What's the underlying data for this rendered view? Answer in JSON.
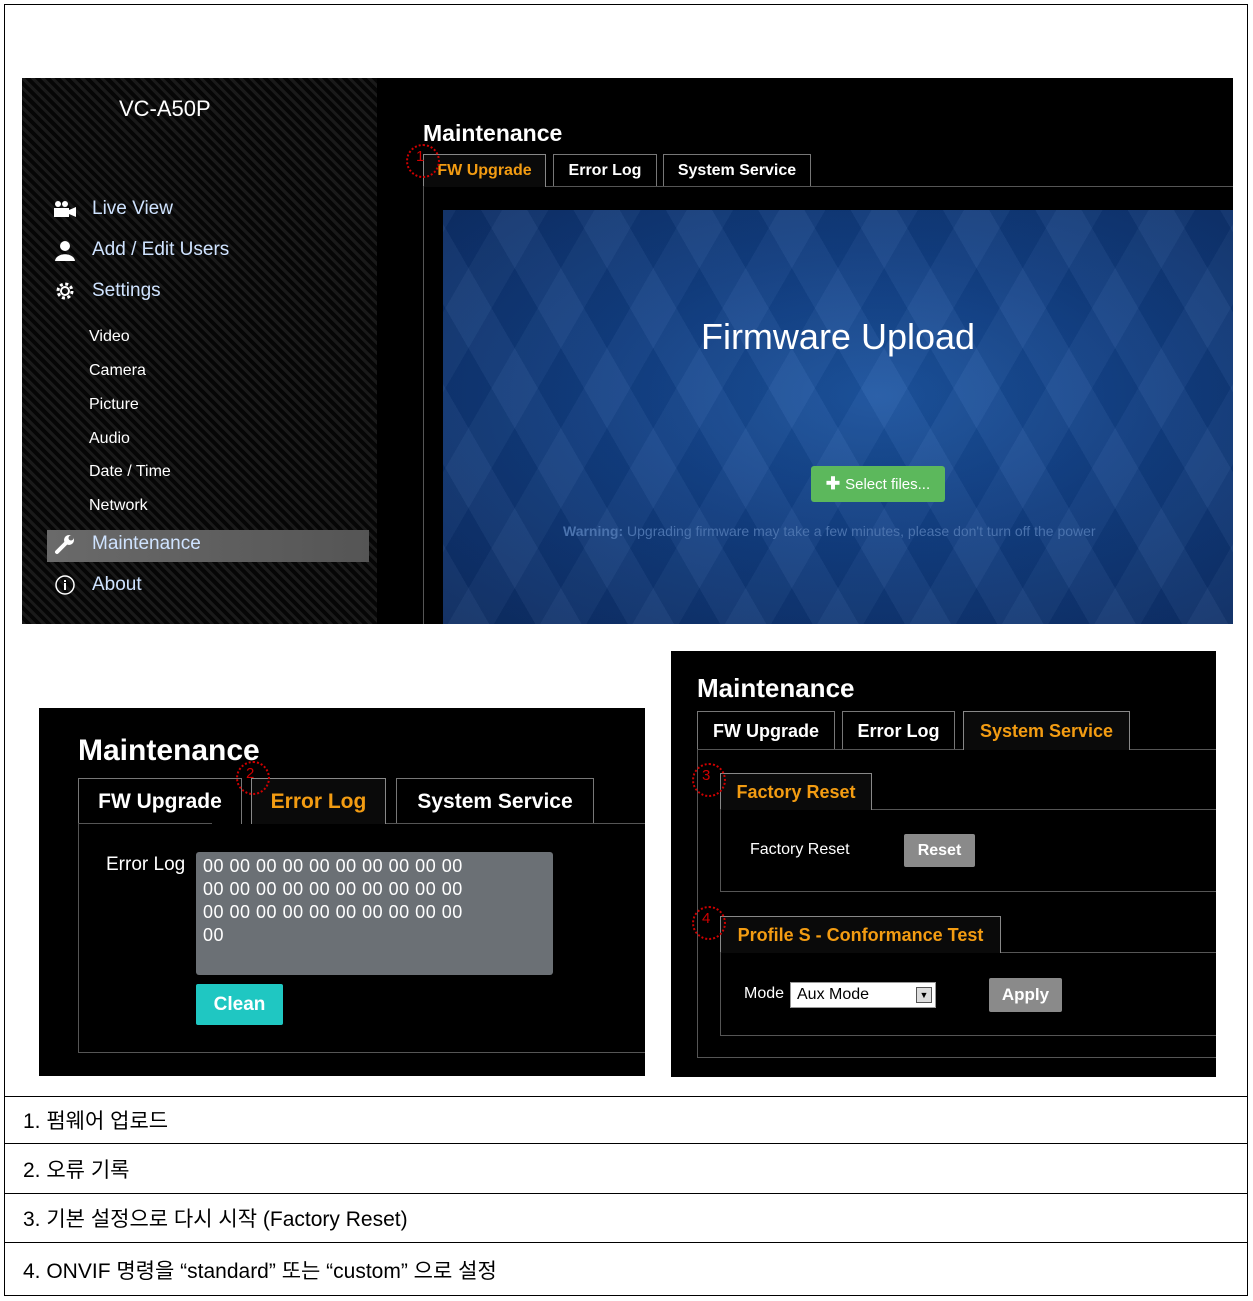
{
  "main": {
    "brand": "VC-A50P",
    "nav": [
      {
        "label": "Live View",
        "icon": "video-camera-icon"
      },
      {
        "label": "Add / Edit Users",
        "icon": "user-icon"
      },
      {
        "label": "Settings",
        "icon": "gear-icon"
      }
    ],
    "settings_sub": [
      "Video",
      "Camera",
      "Picture",
      "Audio",
      "Date / Time",
      "Network"
    ],
    "nav_bottom": [
      {
        "label": "Maintenance",
        "icon": "wrench-icon",
        "active": true
      },
      {
        "label": "About",
        "icon": "info-icon"
      }
    ],
    "title": "Maintenance",
    "tabs": [
      "FW Upgrade",
      "Error Log",
      "System Service"
    ],
    "active_tab": "FW Upgrade",
    "fw_title": "Firmware Upload",
    "select_files": "Select files...",
    "warning_label": "Warning:",
    "warning_text": "Upgrading firmware may take a few minutes, please don't turn off the power"
  },
  "errorlog": {
    "title": "Maintenance",
    "tabs": [
      "FW Upgrade",
      "Error Log",
      "System Service"
    ],
    "active_tab": "Error Log",
    "field_label": "Error Log",
    "log_lines": [
      "00 00 00 00 00 00 00 00 00 00",
      "00 00 00 00 00 00 00 00 00 00",
      "00 00 00 00 00 00 00 00 00 00",
      "00"
    ],
    "clean_button": "Clean"
  },
  "system": {
    "title": "Maintenance",
    "tabs": [
      "FW Upgrade",
      "Error Log",
      "System Service"
    ],
    "active_tab": "System Service",
    "factory_reset_tab": "Factory Reset",
    "factory_reset_label": "Factory Reset",
    "reset_button": "Reset",
    "profile_tab": "Profile S - Conformance Test",
    "mode_label": "Mode",
    "mode_value": "Aux Mode",
    "apply_button": "Apply"
  },
  "callouts": [
    "1",
    "2",
    "3",
    "4"
  ],
  "legend": [
    "1. 펌웨어 업로드",
    "2. 오류 기록",
    "3. 기본 설정으로 다시 시작 (Factory Reset)",
    "4. ONVIF 명령을 “standard” 또는 “custom” 으로 설정"
  ],
  "colors": {
    "active_tab": "#f39c12",
    "select_files": "#5cb85c",
    "clean": "#1fc7c2",
    "callout": "#d00000"
  }
}
